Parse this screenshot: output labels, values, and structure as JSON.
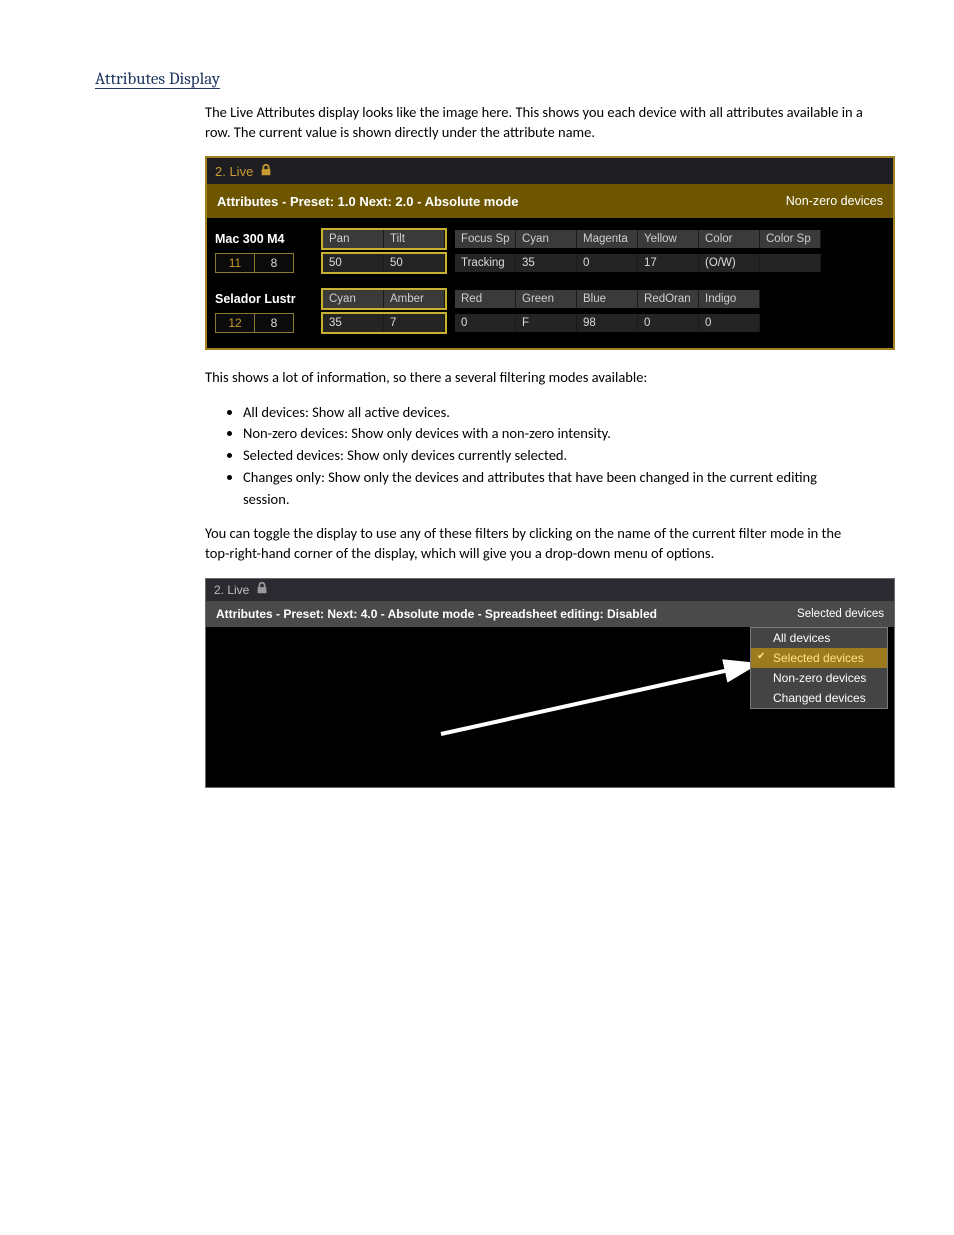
{
  "doc": {
    "heading": "Attributes Display",
    "para1": "The Live Attributes display looks like the image here. This shows you each device with all attributes available in a row. The current value is shown directly under the attribute name.",
    "intro_line": "This shows a lot of information, so there a several filtering modes available:",
    "bullets": [
      "All devices: Show all active devices.",
      "Non-zero devices: Show only devices with a non-zero intensity.",
      "Selected devices: Show only devices currently selected.",
      "Changes only: Show only the devices and attributes that have been changed in the current editing session."
    ],
    "para2": "You can toggle the display to use any of these filters by clicking on the name of the current filter mode in the top-right-hand corner of the display, which will give you a drop-down menu of options."
  },
  "shot1": {
    "tab": "2. Live",
    "header_left": "Attributes - Preset: 1.0 Next: 2.0 - Absolute mode",
    "header_right": "Non-zero devices",
    "devices": [
      {
        "name": "Mac 300 M4",
        "channel": "11",
        "intensity": "8",
        "attrs": [
          {
            "name": "Pan",
            "val": "50"
          },
          {
            "name": "Tilt",
            "val": "50"
          },
          {
            "name": "Focus Sp",
            "val": "Tracking"
          },
          {
            "name": "Cyan",
            "val": "35"
          },
          {
            "name": "Magenta",
            "val": "0"
          },
          {
            "name": "Yellow",
            "val": "17"
          },
          {
            "name": "Color",
            "val": "(O/W)"
          },
          {
            "name": "Color Sp",
            "val": ""
          }
        ]
      },
      {
        "name": "Selador Lustr",
        "channel": "12",
        "intensity": "8",
        "attrs": [
          {
            "name": "Cyan",
            "val": "35"
          },
          {
            "name": "Amber",
            "val": "7"
          },
          {
            "name": "Red",
            "val": "0"
          },
          {
            "name": "Green",
            "val": "F"
          },
          {
            "name": "Blue",
            "val": "98"
          },
          {
            "name": "RedOran",
            "val": "0"
          },
          {
            "name": "Indigo",
            "val": "0"
          }
        ]
      }
    ]
  },
  "shot2": {
    "tab": "2. Live",
    "header_left": "Attributes - Preset:  Next: 4.0 - Absolute mode - Spreadsheet editing: Disabled",
    "header_right": "Selected devices",
    "menu": [
      {
        "label": "All devices",
        "selected": false
      },
      {
        "label": "Selected devices",
        "selected": true
      },
      {
        "label": "Non-zero devices",
        "selected": false
      },
      {
        "label": "Changed devices",
        "selected": false
      }
    ]
  }
}
